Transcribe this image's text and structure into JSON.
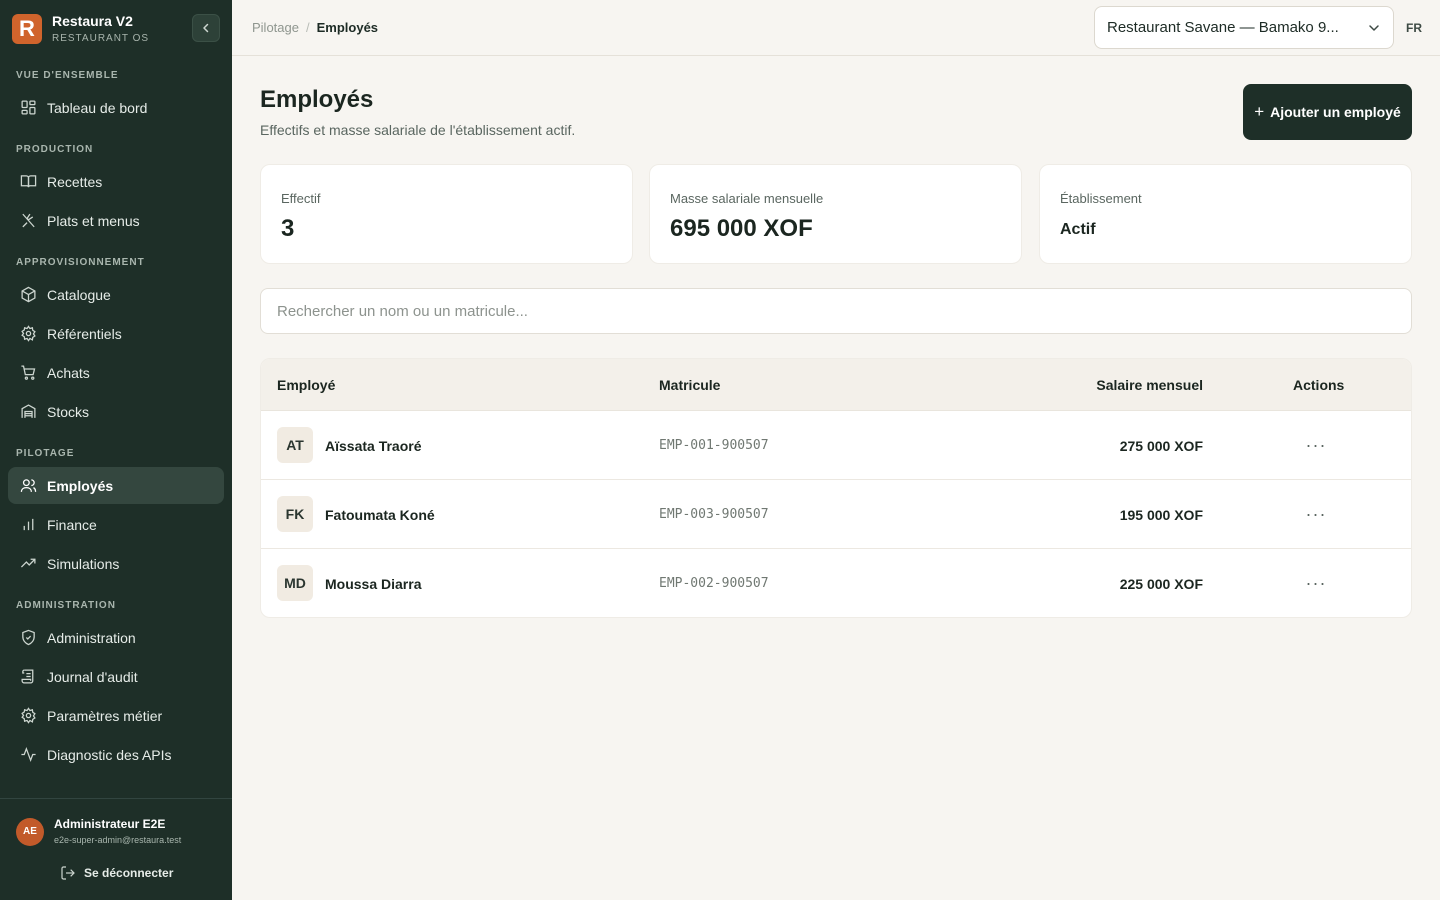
{
  "brand": {
    "logo_letter": "R",
    "name": "Restaura V2",
    "subtitle": "RESTAURANT OS",
    "logo_color": "#d0642c"
  },
  "sidebar": {
    "sections": [
      {
        "title": "VUE D'ENSEMBLE",
        "items": [
          {
            "label": "Tableau de bord",
            "icon": "dashboard-icon"
          }
        ]
      },
      {
        "title": "PRODUCTION",
        "items": [
          {
            "label": "Recettes",
            "icon": "book-icon"
          },
          {
            "label": "Plats et menus",
            "icon": "utensils-icon"
          }
        ]
      },
      {
        "title": "APPROVISIONNEMENT",
        "items": [
          {
            "label": "Catalogue",
            "icon": "package-icon"
          },
          {
            "label": "Référentiels",
            "icon": "gear-icon"
          },
          {
            "label": "Achats",
            "icon": "cart-icon"
          },
          {
            "label": "Stocks",
            "icon": "warehouse-icon"
          }
        ]
      },
      {
        "title": "PILOTAGE",
        "items": [
          {
            "label": "Employés",
            "icon": "users-icon",
            "active": true
          },
          {
            "label": "Finance",
            "icon": "bar-chart-icon"
          },
          {
            "label": "Simulations",
            "icon": "trend-icon"
          }
        ]
      },
      {
        "title": "ADMINISTRATION",
        "items": [
          {
            "label": "Administration",
            "icon": "shield-icon"
          },
          {
            "label": "Journal d'audit",
            "icon": "scroll-icon"
          },
          {
            "label": "Paramètres métier",
            "icon": "gear-icon"
          },
          {
            "label": "Diagnostic des APIs",
            "icon": "pulse-icon"
          }
        ]
      }
    ]
  },
  "user": {
    "initials": "AE",
    "name": "Administrateur E2E",
    "email": "e2e-super-admin@restaura.test",
    "logout_label": "Se déconnecter"
  },
  "topbar": {
    "breadcrumb": [
      "Pilotage",
      "Employés"
    ],
    "restaurant": "Restaurant Savane — Bamako 9...",
    "language": "FR"
  },
  "page": {
    "title": "Employés",
    "subtitle": "Effectifs et masse salariale de l'établissement actif.",
    "add_button": "Ajouter un employé"
  },
  "stats": [
    {
      "label": "Effectif",
      "value": "3"
    },
    {
      "label": "Masse salariale mensuelle",
      "value": "695 000 XOF"
    },
    {
      "label": "Établissement",
      "value": "Actif"
    }
  ],
  "search": {
    "placeholder": "Rechercher un nom ou un matricule...",
    "value": ""
  },
  "table": {
    "columns": [
      "Employé",
      "Matricule",
      "Salaire mensuel",
      "Actions"
    ],
    "rows": [
      {
        "initials": "AT",
        "name": "Aïssata Traoré",
        "id": "EMP-001-900507",
        "salary": "275 000 XOF",
        "actions": "···"
      },
      {
        "initials": "FK",
        "name": "Fatoumata Koné",
        "id": "EMP-003-900507",
        "salary": "195 000 XOF",
        "actions": "···"
      },
      {
        "initials": "MD",
        "name": "Moussa Diarra",
        "id": "EMP-002-900507",
        "salary": "225 000 XOF",
        "actions": "···"
      }
    ]
  }
}
